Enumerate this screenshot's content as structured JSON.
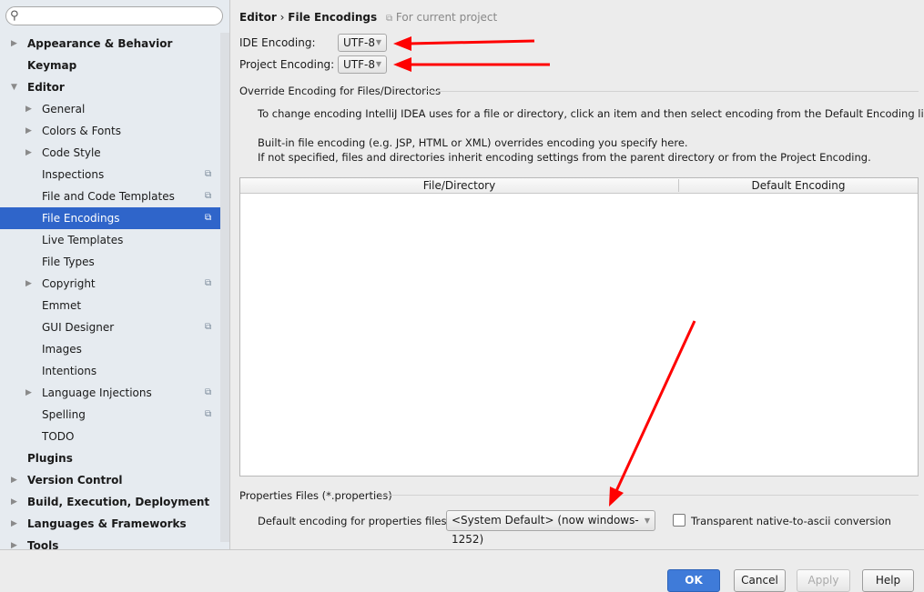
{
  "search": {
    "placeholder": "",
    "icon": "search-icon"
  },
  "sidebar": {
    "items": [
      {
        "label": "Appearance & Behavior",
        "bold": true,
        "arrow": "right",
        "level": 0
      },
      {
        "label": "Keymap",
        "bold": true,
        "arrow": "",
        "level": 0
      },
      {
        "label": "Editor",
        "bold": true,
        "arrow": "down",
        "level": 0
      },
      {
        "label": "General",
        "arrow": "right",
        "level": 1
      },
      {
        "label": "Colors & Fonts",
        "arrow": "right",
        "level": 1
      },
      {
        "label": "Code Style",
        "arrow": "right",
        "level": 1
      },
      {
        "label": "Inspections",
        "level": 1,
        "project": true
      },
      {
        "label": "File and Code Templates",
        "level": 1,
        "project": true
      },
      {
        "label": "File Encodings",
        "level": 1,
        "project": true,
        "selected": true
      },
      {
        "label": "Live Templates",
        "level": 1
      },
      {
        "label": "File Types",
        "level": 1
      },
      {
        "label": "Copyright",
        "arrow": "right",
        "level": 1,
        "project": true
      },
      {
        "label": "Emmet",
        "level": 1
      },
      {
        "label": "GUI Designer",
        "level": 1,
        "project": true
      },
      {
        "label": "Images",
        "level": 1
      },
      {
        "label": "Intentions",
        "level": 1
      },
      {
        "label": "Language Injections",
        "arrow": "right",
        "level": 1,
        "project": true
      },
      {
        "label": "Spelling",
        "level": 1,
        "project": true
      },
      {
        "label": "TODO",
        "level": 1
      },
      {
        "label": "Plugins",
        "bold": true,
        "level": 0
      },
      {
        "label": "Version Control",
        "bold": true,
        "arrow": "right",
        "level": 0
      },
      {
        "label": "Build, Execution, Deployment",
        "bold": true,
        "arrow": "right",
        "level": 0
      },
      {
        "label": "Languages & Frameworks",
        "bold": true,
        "arrow": "right",
        "level": 0
      },
      {
        "label": "Tools",
        "bold": true,
        "arrow": "right",
        "level": 0
      }
    ]
  },
  "breadcrumb": {
    "parent": "Editor",
    "sep": "›",
    "current": "File Encodings",
    "scope": "For current project"
  },
  "ide_encoding": {
    "label": "IDE Encoding:",
    "value": "UTF-8"
  },
  "project_encoding": {
    "label": "Project Encoding:",
    "value": "UTF-8"
  },
  "override": {
    "title": "Override Encoding for Files/Directories",
    "desc1": "To change encoding IntelliJ IDEA uses for a file or directory, click an item and then select encoding from the Default Encoding list.",
    "desc2": "Built-in file encoding (e.g. JSP, HTML or XML) overrides encoding you specify here.",
    "desc3": "If not specified, files and directories inherit encoding settings from the parent directory or from the Project Encoding.",
    "columns": [
      "File/Directory",
      "Default Encoding"
    ]
  },
  "properties": {
    "title": "Properties Files (*.properties)",
    "label": "Default encoding for properties files:",
    "value": "<System Default> (now windows-1252)",
    "checkbox_label": "Transparent native-to-ascii conversion",
    "checked": false
  },
  "buttons": {
    "ok": "OK",
    "cancel": "Cancel",
    "apply": "Apply",
    "help": "Help"
  },
  "colors": {
    "selection": "#2f65ca",
    "annotation_arrows": "#ff0000",
    "ok_button": "#3f7bd9"
  }
}
